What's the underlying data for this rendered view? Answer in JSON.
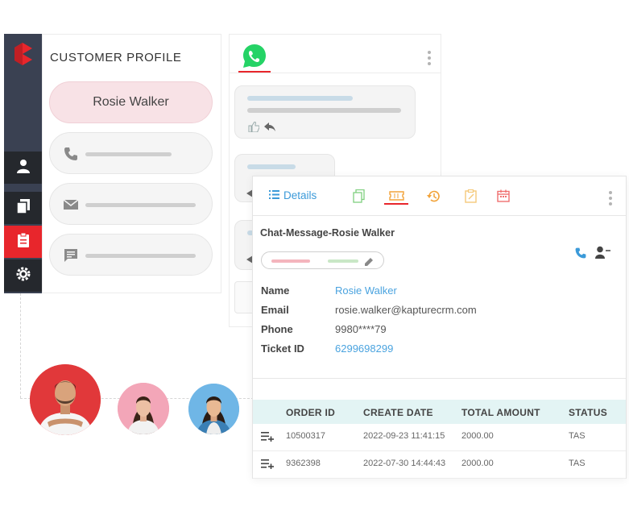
{
  "profile": {
    "title": "CUSTOMER PROFILE",
    "name": "Rosie Walker"
  },
  "sidebar": {
    "items": [
      {
        "icon": "user-icon"
      },
      {
        "icon": "documents-icon"
      },
      {
        "icon": "clipboard-icon",
        "active": true
      },
      {
        "icon": "gear-icon"
      }
    ]
  },
  "details": {
    "tab_label": "Details",
    "chat_title": "Chat-Message-Rosie Walker",
    "fields": [
      {
        "label": "Name",
        "value": "Rosie Walker"
      },
      {
        "label": "Email",
        "value": "rosie.walker@kapturecrm.com"
      },
      {
        "label": "Phone",
        "value": "9980****79"
      },
      {
        "label": "Ticket ID",
        "value": "6299698299"
      }
    ],
    "table": {
      "headers": [
        "ORDER ID",
        "CREATE DATE",
        "TOTAL AMOUNT",
        "STATUS"
      ],
      "rows": [
        [
          "10500317",
          "2022-09-23 11:41:15",
          "2000.00",
          "TAS"
        ],
        [
          "9362398",
          "2022-07-30 14:44:43",
          "2000.00",
          "TAS"
        ]
      ]
    }
  },
  "colors": {
    "brand_red": "#e8262c",
    "sidebar_dark": "#3a4152",
    "link_blue": "#3b9ad9",
    "whatsapp_green": "#25d366",
    "table_header_bg": "#e3f4f4"
  }
}
